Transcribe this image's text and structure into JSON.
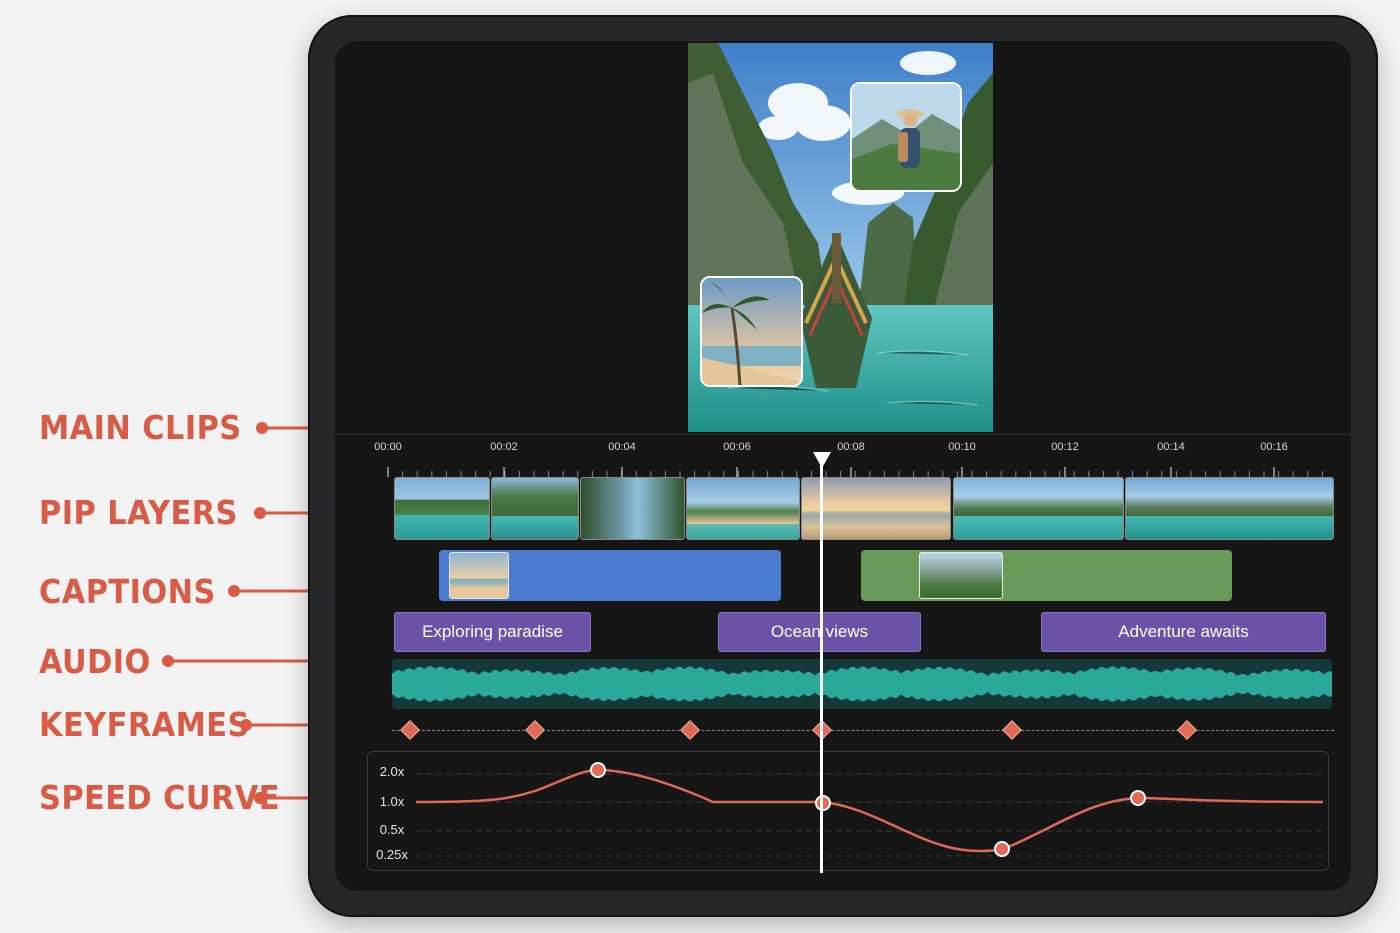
{
  "callouts": [
    {
      "label": "MAIN CLIPS"
    },
    {
      "label": "PIP LAYERS"
    },
    {
      "label": "CAPTIONS"
    },
    {
      "label": "AUDIO"
    },
    {
      "label": "KEYFRAMES"
    },
    {
      "label": "SPEED CURVE"
    }
  ],
  "timeline": {
    "ticks": [
      "00:00",
      "00:02",
      "00:04",
      "00:06",
      "00:08",
      "00:10",
      "00:12",
      "00:14",
      "00:16"
    ],
    "captions": [
      "Exploring paradise",
      "Ocean views",
      "Adventure awaits"
    ],
    "speed_labels": [
      "2.0x",
      "1.0x",
      "0.5x",
      "0.25x"
    ]
  },
  "colors": {
    "accent": "#d95a45",
    "pip_blue": "#4a7bd0",
    "pip_green": "#6a9a58",
    "caption_purple": "#6a52a8",
    "audio_teal": "#2aa89a"
  },
  "icons": {
    "playhead": "playhead-marker-icon",
    "keyframe": "keyframe-diamond-icon"
  }
}
